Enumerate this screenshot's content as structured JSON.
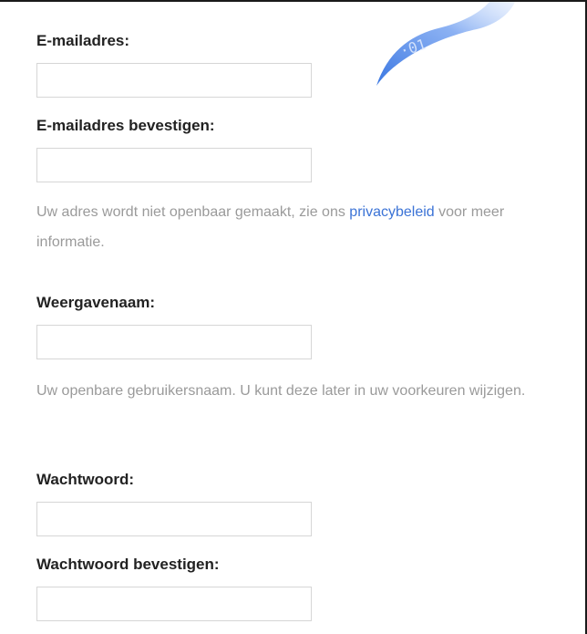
{
  "form": {
    "email": {
      "label": "E-mailadres:",
      "value": "",
      "placeholder": ""
    },
    "email_confirm": {
      "label": "E-mailadres bevestigen:",
      "value": "",
      "placeholder": ""
    },
    "email_help": {
      "before_link": "Uw adres wordt niet openbaar gemaakt, zie ons ",
      "link_text": "privacybeleid",
      "after_link": " voor meer informatie."
    },
    "display_name": {
      "label": "Weergavenaam:",
      "value": "",
      "placeholder": ""
    },
    "display_name_help": "Uw openbare gebruikersnaam. U kunt deze later in uw voorkeuren wijzigen.",
    "password": {
      "label": "Wachtwoord:",
      "value": "",
      "placeholder": ""
    },
    "password_confirm": {
      "label": "Wachtwoord bevestigen:",
      "value": "",
      "placeholder": ""
    }
  },
  "colors": {
    "link": "#3b73d6",
    "help_text": "#9a9a9a",
    "label_text": "#222222",
    "input_border": "#d6d6d6",
    "decor_blue": "#5b8de8"
  }
}
